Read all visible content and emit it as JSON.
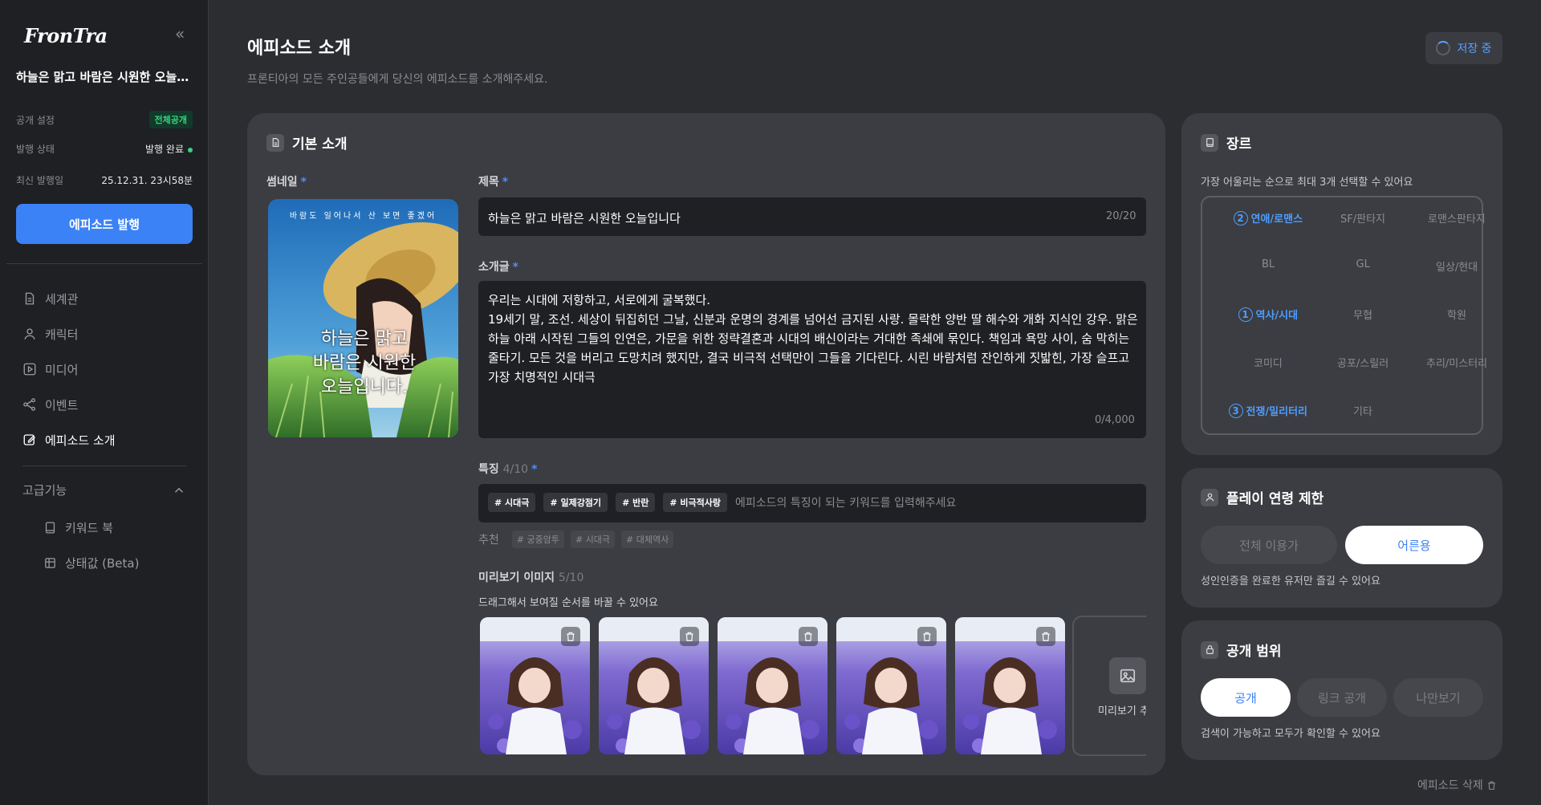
{
  "sidebar": {
    "logo": "FronTra",
    "episode_title": "하늘은 맑고 바람은 시원한 오늘입니다",
    "meta": [
      {
        "key": "공개 설정",
        "value": "전체공개"
      },
      {
        "key": "발행 상태",
        "value": "발행 완료"
      },
      {
        "key": "최신 발행일",
        "value": "25.12.31. 23시58분"
      }
    ],
    "publish_button": "에피소드 발행",
    "nav": [
      {
        "label": "세계관",
        "icon": "document-icon"
      },
      {
        "label": "캐릭터",
        "icon": "user-icon"
      },
      {
        "label": "미디어",
        "icon": "play-icon"
      },
      {
        "label": "이벤트",
        "icon": "share-icon"
      },
      {
        "label": "에피소드 소개",
        "icon": "edit-icon"
      }
    ],
    "advanced": {
      "label": "고급기능",
      "items": [
        {
          "label": "키워드 북",
          "icon": "book-icon"
        },
        {
          "label": "상태값 (Beta)",
          "icon": "status-icon"
        }
      ]
    }
  },
  "header": {
    "title": "에피소드 소개",
    "subtitle": "프론티아의 모든 주인공들에게 당신의 에피소드를 소개해주세요.",
    "save_status": "저장 중"
  },
  "basic": {
    "section_title": "기본 소개",
    "thumbnail_label": "썸네일",
    "thumbnail_caption_top": "바람도 일어나서 산 보면 좋겠어",
    "thumbnail_caption": [
      "하늘은 맑고",
      "바람은 시원한",
      "오늘입니다."
    ],
    "title_label": "제목",
    "title_value": "하늘은 맑고 바람은 시원한 오늘입니다",
    "title_counter": "20/20",
    "intro_label": "소개글",
    "intro_lines": [
      "우리는 시대에 저항하고, 서로에게 굴복했다.",
      "19세기 말, 조선. 세상이 뒤집히던 그날, 신분과 운명의 경계를 넘어선 금지된 사랑. 몰락한 양반 딸 해수와 개화 지식인 강우. 맑은 하늘 아래 시작된 그들의 인연은, 가문을 위한 정략결혼과 시대의 배신이라는 거대한 족쇄에 묶인다. 책임과 욕망 사이, 숨 막히는 줄타기. 모든 것을 버리고 도망치려 했지만, 결국 비극적 선택만이 그들을 기다린다. 시린 바람처럼 잔인하게 짓밟힌, 가장 슬프고 가장 치명적인 시대극"
    ],
    "intro_counter": "0/4,000",
    "features_label": "특징",
    "features_count": "4/10",
    "tags": [
      "# 시대극",
      "# 일제강점기",
      "# 반란",
      "# 비극적사랑"
    ],
    "tags_placeholder": "에피소드의 특징이 되는 키워드를 입력해주세요",
    "recommend_label": "추천",
    "recommend_tags": [
      "# 궁중암투",
      "# 시대극",
      "# 대체역사"
    ],
    "preview_label": "미리보기 이미지",
    "preview_count": "5/10",
    "preview_hint": "드래그해서 보여질 순서를 바꿀 수 있어요",
    "preview_add_label": "미리보기 추"
  },
  "genre": {
    "title": "장르",
    "hint": "가장 어울리는 순으로 최대 3개 선택할 수 있어요",
    "items": [
      {
        "label": "연애/로맨스",
        "rank": "2"
      },
      {
        "label": "SF/판타지",
        "rank": ""
      },
      {
        "label": "로맨스판타지",
        "rank": ""
      },
      {
        "label": "BL",
        "rank": ""
      },
      {
        "label": "GL",
        "rank": ""
      },
      {
        "label": "일상/현대",
        "rank": ""
      },
      {
        "label": "역사/시대",
        "rank": "1"
      },
      {
        "label": "무협",
        "rank": ""
      },
      {
        "label": "학원",
        "rank": ""
      },
      {
        "label": "코미디",
        "rank": ""
      },
      {
        "label": "공포/스릴러",
        "rank": ""
      },
      {
        "label": "추리/미스터리",
        "rank": ""
      },
      {
        "label": "전쟁/밀리터리",
        "rank": "3"
      },
      {
        "label": "기타",
        "rank": ""
      }
    ]
  },
  "age": {
    "title": "플레이 연령 제한",
    "options": [
      "전체 이용가",
      "어른용"
    ],
    "selected": "어른용",
    "hint": "성인인증을 완료한 유저만 즐길 수 있어요"
  },
  "visibility": {
    "title": "공개 범위",
    "options": [
      "공개",
      "링크 공개",
      "나만보기"
    ],
    "selected": "공개",
    "hint": "검색이 가능하고 모두가 확인할 수 있어요"
  },
  "delete_label": "에피소드 삭제",
  "colors": {
    "accent": "#3b82f6",
    "public_badge": "#39d37d"
  }
}
